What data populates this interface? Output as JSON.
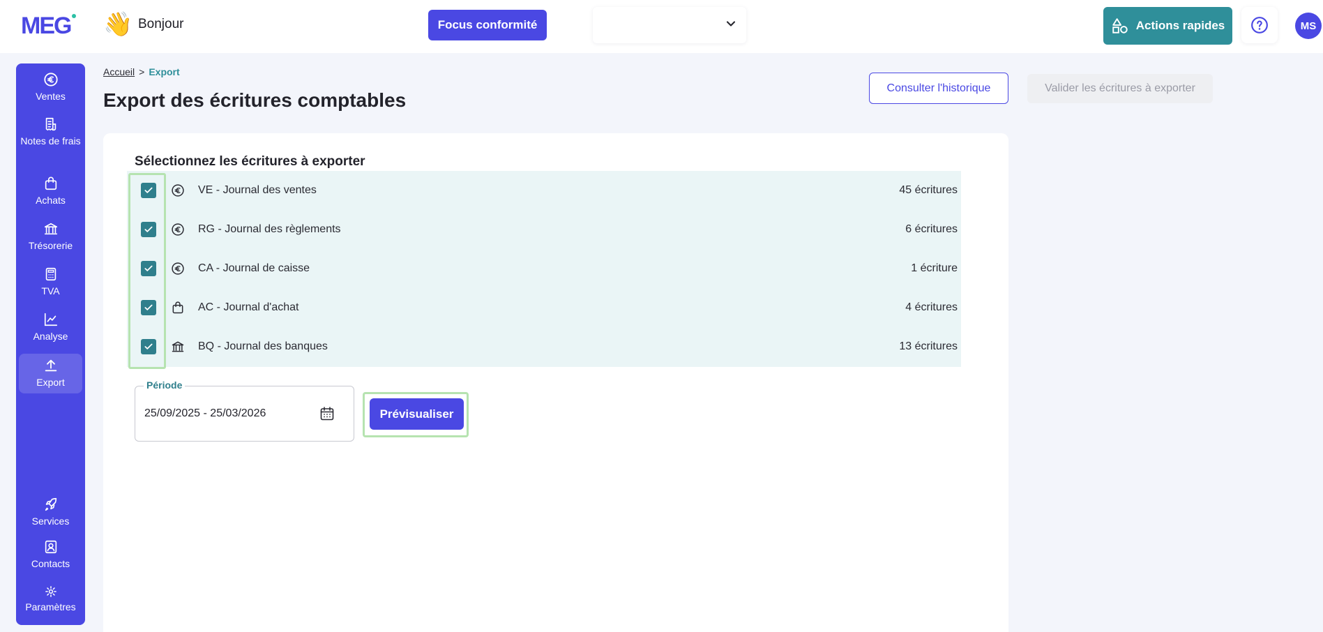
{
  "header": {
    "logo": "MEG",
    "greeting": "Bonjour",
    "greeting_emoji": "👋",
    "focus_label": "Focus conformité",
    "company_select_value": "",
    "quick_actions_label": "Actions rapides",
    "help_icon": "question-circle-icon",
    "avatar_initials": "MS"
  },
  "sidebar": {
    "items": [
      {
        "label": "Ventes",
        "icon": "euro-circle-icon"
      },
      {
        "label": "Notes de frais",
        "icon": "receipt-icon"
      },
      {
        "label": "Achats",
        "icon": "shopping-bag-icon"
      },
      {
        "label": "Trésorerie",
        "icon": "bank-icon"
      },
      {
        "label": "TVA",
        "icon": "calculator-icon"
      },
      {
        "label": "Analyse",
        "icon": "line-chart-icon"
      },
      {
        "label": "Export",
        "icon": "upload-icon"
      }
    ],
    "bottom_items": [
      {
        "label": "Services",
        "icon": "rocket-icon"
      },
      {
        "label": "Contacts",
        "icon": "contact-card-icon"
      },
      {
        "label": "Paramètres",
        "icon": "gear-icon"
      }
    ],
    "active": "Export"
  },
  "breadcrumb": {
    "home": "Accueil",
    "separator": ">",
    "current": "Export"
  },
  "page": {
    "title": "Export des écritures comptables",
    "history_button": "Consulter l'historique",
    "validate_button": "Valider les écritures à exporter"
  },
  "selection": {
    "title": "Sélectionnez les écritures à exporter",
    "journals": [
      {
        "label": "VE - Journal des ventes",
        "count": "45 écritures",
        "icon": "euro-circle-icon",
        "checked": true
      },
      {
        "label": "RG - Journal des règlements",
        "count": "6 écritures",
        "icon": "euro-circle-icon",
        "checked": true
      },
      {
        "label": "CA - Journal de caisse",
        "count": "1 écriture",
        "icon": "euro-circle-icon",
        "checked": true
      },
      {
        "label": "AC - Journal d'achat",
        "count": "4 écritures",
        "icon": "shopping-bag-icon",
        "checked": true
      },
      {
        "label": "BQ - Journal des banques",
        "count": "13 écritures",
        "icon": "bank-icon",
        "checked": true
      }
    ]
  },
  "period": {
    "label": "Période",
    "value": "25/09/2025 - 25/03/2026"
  },
  "preview_button": "Prévisualiser",
  "colors": {
    "primary": "#4a48e3",
    "teal": "#2f8f9a",
    "row_bg": "#eaf5f6",
    "highlight": "#b6e3b0"
  }
}
